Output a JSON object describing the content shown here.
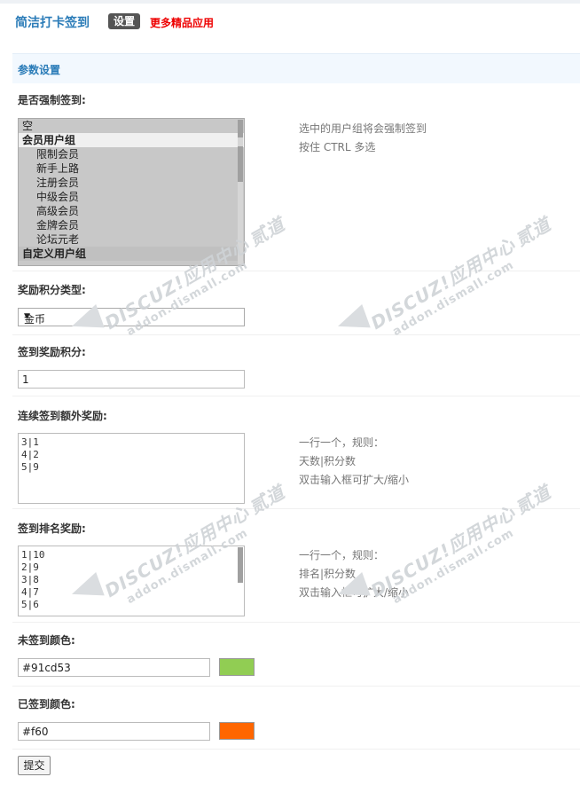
{
  "header": {
    "app_title": "简洁打卡签到",
    "tab_settings": "设置",
    "more_apps_link": "更多精品应用"
  },
  "section": {
    "title": "参数设置"
  },
  "force_signin": {
    "label": "是否强制签到:",
    "options": [
      {
        "label": "空",
        "type": "item"
      },
      {
        "label": "会员用户组",
        "type": "group"
      },
      {
        "label": "限制会员",
        "type": "sub"
      },
      {
        "label": "新手上路",
        "type": "sub"
      },
      {
        "label": "注册会员",
        "type": "sub"
      },
      {
        "label": "中级会员",
        "type": "sub"
      },
      {
        "label": "高级会员",
        "type": "sub"
      },
      {
        "label": "金牌会员",
        "type": "sub"
      },
      {
        "label": "论坛元老",
        "type": "sub"
      },
      {
        "label": "自定义用户组",
        "type": "group"
      }
    ],
    "hint_1": "选中的用户组将会强制签到",
    "hint_2": "按住 CTRL 多选"
  },
  "reward_type": {
    "label": "奖励积分类型:",
    "selected": "金币"
  },
  "reward_points": {
    "label": "签到奖励积分:",
    "value": "1"
  },
  "streak_reward": {
    "label": "连续签到额外奖励:",
    "lines": [
      "3|1",
      "4|2",
      "5|9"
    ],
    "hint_1": "一行一个，规则：",
    "hint_2": "天数|积分数",
    "hint_3": "双击输入框可扩大/缩小"
  },
  "rank_reward": {
    "label": "签到排名奖励:",
    "lines": [
      "1|10",
      "2|9",
      "3|8",
      "4|7",
      "5|6"
    ],
    "hint_1": "一行一个，规则：",
    "hint_2": "排名|积分数",
    "hint_3": "双击输入框可扩大/缩小"
  },
  "unsigned_color": {
    "label": "未签到颜色:",
    "value": "#91cd53",
    "swatch": "#91cd53"
  },
  "signed_color": {
    "label": "已签到颜色:",
    "value": "#f60",
    "swatch": "#ff6600"
  },
  "submit_label": "提交",
  "watermark": {
    "brand": "DISCUZ!应用中心",
    "url": "addon.dismall.com",
    "tag": "贰道"
  },
  "colors": {
    "accent": "#2b7cb8",
    "link_red": "#ee0000",
    "section_bg": "#f2f8fe"
  }
}
